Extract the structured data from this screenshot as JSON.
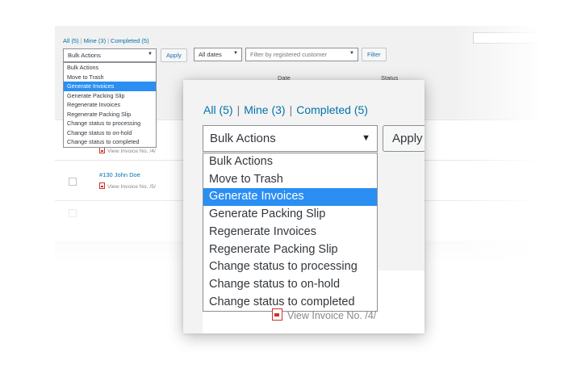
{
  "views": {
    "all": "All",
    "all_count": "(5)",
    "mine": "Mine",
    "mine_count": "(3)",
    "completed": "Completed",
    "completed_count": "(5)",
    "separator": "|"
  },
  "toolbar": {
    "bulk_actions": "Bulk Actions",
    "apply": "Apply",
    "dates": "All dates",
    "customer_placeholder": "Filter by registered customer",
    "filter": "Filter"
  },
  "bulk_options": [
    "Bulk Actions",
    "Move to Trash",
    "Generate Invoices",
    "Generate Packing Slip",
    "Regenerate Invoices",
    "Regenerate Packing Slip",
    "Change status to processing",
    "Change status to on-hold",
    "Change status to completed"
  ],
  "selected_option": "Generate Invoices",
  "table": {
    "col_date": "Date",
    "col_status": "Status"
  },
  "rows": [
    {
      "order": "",
      "invoice": "View Invoice No. /4/"
    },
    {
      "order": "#130 John Doe",
      "invoice": "View Invoice No. /5/"
    }
  ],
  "zoom_invoice": "View Invoice No. /4/",
  "colors": {
    "link": "#0073aa",
    "selected_bg": "#2b8ef3",
    "pdf_icon": "#d0302b"
  }
}
